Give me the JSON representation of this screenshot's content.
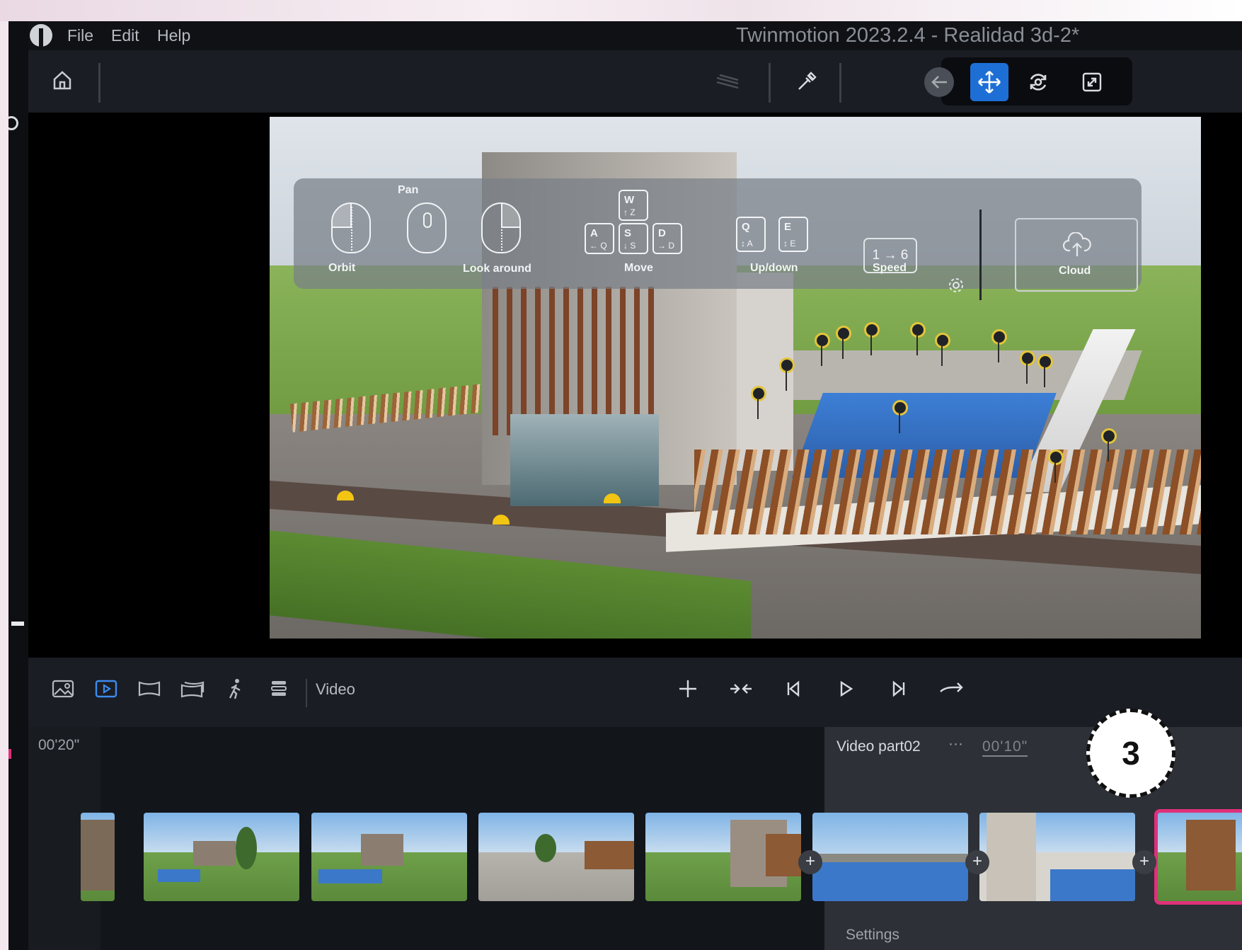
{
  "menu": {
    "items": [
      "File",
      "Edit",
      "Help"
    ],
    "title": "Twinmotion 2023.2.4 - Realidad 3d-2*"
  },
  "toolbar": {
    "icons": [
      "home-icon",
      "layers-icon",
      "eyedropper-icon",
      "back-arrow-icon",
      "move-icon",
      "orbit-icon",
      "expand-icon"
    ],
    "active": "move-icon",
    "accent": "#1d6fd6"
  },
  "hud": {
    "orbit": "Orbit",
    "pan": "Pan",
    "look_around": "Look around",
    "move": "Move",
    "updown": "Up/down",
    "speed": "Speed",
    "speed_value": "1 → 6",
    "cloud": "Cloud",
    "keys": {
      "w": {
        "main": "W",
        "sub": "↑ Z"
      },
      "a": {
        "main": "A",
        "sub": "← Q"
      },
      "s": {
        "main": "S",
        "sub": "↓ S"
      },
      "d": {
        "main": "D",
        "sub": "→ D"
      },
      "q": {
        "main": "Q",
        "sub": "↕ A"
      },
      "e": {
        "main": "E",
        "sub": "↕ E"
      }
    }
  },
  "bottom": {
    "icons": [
      "image-icon",
      "video-icon",
      "panorama-icon",
      "panorama-set-icon",
      "walk-icon",
      "stack-icon"
    ],
    "active": "video-icon",
    "label": "Video",
    "controls": [
      "add-icon",
      "merge-icon",
      "skip-start-icon",
      "play-icon",
      "skip-end-icon",
      "loop-icon"
    ]
  },
  "timeline": {
    "time": "00'20\"",
    "part_title": "Video part02",
    "more": "···",
    "duration": "00'10\"",
    "settings": "Settings",
    "selected_color": "#e0307a"
  },
  "badge": {
    "number": "3"
  }
}
